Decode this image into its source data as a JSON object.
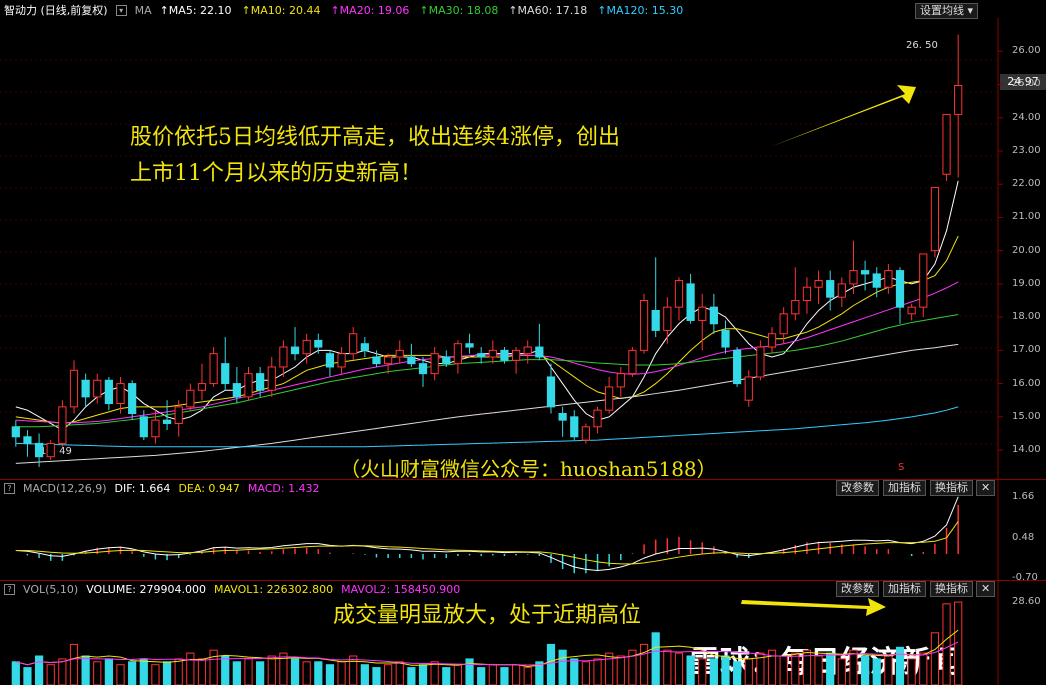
{
  "header": {
    "title": "智动力 (日线,前复权)",
    "ma_prefix": "MA",
    "ma": [
      {
        "label": "MA5: 22.10",
        "color": "#ffffff"
      },
      {
        "label": "MA10: 20.44",
        "color": "#f2e40a"
      },
      {
        "label": "MA20: 19.06",
        "color": "#ff33ff"
      },
      {
        "label": "MA30: 18.08",
        "color": "#33cc33"
      },
      {
        "label": "MA60: 17.18",
        "color": "#dddddd"
      },
      {
        "label": "MA120: 15.30",
        "color": "#33ccff"
      }
    ],
    "settings_button": "设置均线"
  },
  "price_panel": {
    "y_ticks": [
      "26.00",
      "25.00",
      "24.00",
      "23.00",
      "22.00",
      "21.00",
      "20.00",
      "19.00",
      "18.00",
      "17.00",
      "16.00",
      "15.00",
      "14.00"
    ],
    "current_price": "24.97",
    "high_label": "26. 50",
    "low_label": "13. 49",
    "marker": "S",
    "annotation_line1": "股价依托5日均线低开高走，收出连续4涨停，创出",
    "annotation_line2": "上市11个月以来的历史新高！",
    "watermark": "（火山财富微信公众号：huoshan5188）"
  },
  "macd_panel": {
    "title": "MACD(12,26,9)",
    "dif": "DIF: 1.664",
    "dea": "DEA: 0.947",
    "macd": "MACD: 1.432",
    "buttons": [
      "改参数",
      "加指标",
      "换指标"
    ],
    "y_ticks": [
      "1.66",
      "0.48",
      "-0.70"
    ]
  },
  "vol_panel": {
    "title": "VOL(5,10)",
    "volume": "VOLUME: 279904.000",
    "mavol1": "MAVOL1: 226302.800",
    "mavol2": "MAVOL2: 158450.900",
    "buttons": [
      "改参数",
      "加指标",
      "换指标"
    ],
    "y_ticks": [
      "28.60"
    ],
    "annotation": "成交量明显放大，处于近期高位",
    "logo": "雪球：每日经济新闻"
  },
  "colors": {
    "up": "#ff3333",
    "down": "#33d9e6",
    "annotation": "#f2e40a"
  },
  "chart_data": {
    "type": "candlestick",
    "ylim": [
      13.4,
      26.7
    ],
    "ohlc": [
      [
        14.7,
        14.9,
        14.1,
        14.4
      ],
      [
        14.4,
        14.6,
        13.8,
        14.2
      ],
      [
        14.2,
        14.5,
        13.49,
        13.8
      ],
      [
        13.8,
        14.3,
        13.7,
        14.2
      ],
      [
        14.2,
        15.5,
        14.1,
        15.3
      ],
      [
        15.3,
        16.7,
        15.1,
        16.4
      ],
      [
        16.1,
        16.3,
        15.3,
        15.6
      ],
      [
        15.6,
        16.3,
        15.4,
        16.1
      ],
      [
        16.1,
        16.2,
        15.2,
        15.4
      ],
      [
        15.4,
        16.2,
        15.1,
        16.0
      ],
      [
        16.0,
        16.1,
        14.9,
        15.1
      ],
      [
        15.0,
        15.2,
        14.3,
        14.4
      ],
      [
        14.4,
        15.2,
        14.2,
        14.9
      ],
      [
        14.9,
        15.5,
        14.6,
        14.8
      ],
      [
        14.8,
        15.5,
        14.4,
        15.3
      ],
      [
        15.3,
        16.0,
        15.2,
        15.8
      ],
      [
        15.8,
        16.6,
        15.5,
        16.0
      ],
      [
        16.0,
        17.1,
        15.9,
        16.9
      ],
      [
        16.6,
        17.4,
        15.8,
        16.0
      ],
      [
        16.0,
        16.5,
        15.4,
        15.6
      ],
      [
        15.6,
        16.5,
        15.5,
        16.3
      ],
      [
        16.3,
        16.5,
        15.6,
        15.8
      ],
      [
        15.8,
        16.8,
        15.6,
        16.5
      ],
      [
        16.5,
        17.3,
        16.2,
        17.1
      ],
      [
        17.1,
        17.7,
        16.7,
        16.9
      ],
      [
        16.9,
        17.5,
        16.6,
        17.3
      ],
      [
        17.3,
        17.5,
        16.9,
        17.1
      ],
      [
        16.9,
        17.0,
        16.2,
        16.5
      ],
      [
        16.5,
        17.1,
        16.3,
        16.9
      ],
      [
        16.9,
        17.7,
        16.7,
        17.5
      ],
      [
        17.2,
        17.4,
        16.8,
        17.0
      ],
      [
        16.8,
        17.0,
        16.5,
        16.6
      ],
      [
        16.6,
        16.9,
        16.3,
        16.8
      ],
      [
        16.8,
        17.3,
        16.6,
        17.0
      ],
      [
        16.8,
        17.2,
        16.5,
        16.6
      ],
      [
        16.6,
        16.8,
        15.9,
        16.3
      ],
      [
        16.3,
        17.1,
        16.1,
        16.9
      ],
      [
        16.8,
        17.0,
        16.5,
        16.6
      ],
      [
        16.6,
        17.3,
        16.3,
        17.2
      ],
      [
        17.2,
        17.5,
        16.9,
        17.1
      ],
      [
        16.9,
        17.1,
        16.6,
        16.8
      ],
      [
        16.8,
        17.3,
        16.6,
        17.0
      ],
      [
        17.0,
        17.1,
        16.6,
        16.7
      ],
      [
        16.7,
        17.1,
        16.3,
        17.0
      ],
      [
        16.9,
        17.3,
        16.6,
        17.1
      ],
      [
        17.1,
        17.8,
        16.7,
        16.8
      ],
      [
        16.2,
        16.6,
        15.1,
        15.3
      ],
      [
        15.1,
        15.3,
        14.4,
        14.9
      ],
      [
        15.0,
        15.2,
        14.3,
        14.4
      ],
      [
        14.3,
        14.8,
        14.2,
        14.7
      ],
      [
        14.7,
        15.3,
        14.5,
        15.2
      ],
      [
        15.2,
        16.2,
        15.1,
        15.9
      ],
      [
        15.9,
        16.5,
        15.6,
        16.3
      ],
      [
        16.3,
        17.1,
        16.2,
        17.0
      ],
      [
        17.0,
        18.7,
        16.9,
        18.5
      ],
      [
        18.2,
        19.8,
        17.4,
        17.6
      ],
      [
        17.6,
        18.6,
        17.2,
        18.3
      ],
      [
        18.3,
        19.2,
        17.9,
        19.1
      ],
      [
        19.0,
        19.3,
        17.8,
        17.9
      ],
      [
        17.9,
        18.7,
        17.0,
        18.3
      ],
      [
        18.3,
        18.7,
        17.5,
        17.8
      ],
      [
        17.6,
        17.9,
        16.9,
        17.1
      ],
      [
        17.0,
        17.1,
        15.9,
        16.0
      ],
      [
        15.5,
        16.4,
        15.3,
        16.2
      ],
      [
        16.2,
        17.3,
        16.1,
        17.1
      ],
      [
        17.1,
        17.7,
        16.9,
        17.5
      ],
      [
        17.5,
        18.3,
        17.2,
        18.1
      ],
      [
        18.1,
        19.5,
        17.9,
        18.5
      ],
      [
        18.5,
        19.2,
        18.1,
        18.9
      ],
      [
        18.9,
        19.4,
        18.4,
        19.1
      ],
      [
        19.1,
        19.4,
        18.2,
        18.6
      ],
      [
        18.6,
        19.2,
        18.3,
        19.0
      ],
      [
        19.0,
        20.3,
        18.7,
        19.4
      ],
      [
        19.4,
        19.7,
        18.8,
        19.3
      ],
      [
        19.3,
        19.5,
        18.6,
        18.9
      ],
      [
        18.9,
        19.6,
        18.7,
        19.4
      ],
      [
        19.4,
        19.5,
        17.8,
        18.3
      ],
      [
        18.1,
        18.4,
        17.9,
        18.3
      ],
      [
        18.3,
        19.9,
        18.0,
        19.9
      ],
      [
        20.0,
        21.9,
        19.8,
        21.9
      ],
      [
        22.3,
        24.1,
        22.1,
        24.1
      ],
      [
        24.1,
        26.5,
        22.2,
        24.97
      ]
    ],
    "ma": {
      "MA5": [
        15.3,
        15.2,
        15.0,
        14.8,
        14.6,
        14.9,
        15.3,
        15.6,
        15.8,
        15.9,
        15.7,
        15.4,
        15.2,
        15.0,
        14.9,
        15.0,
        15.2,
        15.6,
        15.8,
        15.8,
        16.0,
        16.1,
        16.1,
        16.3,
        16.5,
        16.8,
        17.0,
        17.0,
        16.9,
        16.9,
        17.0,
        16.9,
        16.8,
        16.8,
        16.8,
        16.7,
        16.6,
        16.6,
        16.7,
        16.8,
        16.9,
        16.9,
        16.9,
        16.9,
        16.9,
        17.0,
        16.5,
        16.0,
        15.5,
        15.1,
        14.9,
        15.0,
        15.3,
        15.6,
        16.2,
        16.9,
        17.4,
        17.8,
        18.1,
        18.3,
        18.2,
        18.0,
        17.6,
        17.2,
        16.9,
        16.8,
        16.9,
        17.3,
        17.8,
        18.2,
        18.5,
        18.7,
        18.9,
        19.0,
        19.1,
        19.2,
        19.1,
        19.0,
        19.1,
        19.6,
        20.6,
        22.1
      ],
      "MA10": [
        15.0,
        14.95,
        14.9,
        14.85,
        14.8,
        14.85,
        14.95,
        15.05,
        15.15,
        15.25,
        15.3,
        15.3,
        15.3,
        15.3,
        15.35,
        15.4,
        15.45,
        15.5,
        15.55,
        15.6,
        15.7,
        15.8,
        15.9,
        16.0,
        16.2,
        16.4,
        16.5,
        16.6,
        16.65,
        16.7,
        16.75,
        16.8,
        16.85,
        16.85,
        16.85,
        16.85,
        16.85,
        16.8,
        16.8,
        16.8,
        16.8,
        16.8,
        16.8,
        16.85,
        16.85,
        16.85,
        16.7,
        16.45,
        16.2,
        15.95,
        15.75,
        15.65,
        15.55,
        15.6,
        15.75,
        16.0,
        16.3,
        16.65,
        17.0,
        17.3,
        17.55,
        17.65,
        17.65,
        17.55,
        17.45,
        17.35,
        17.35,
        17.45,
        17.55,
        17.7,
        17.9,
        18.1,
        18.35,
        18.55,
        18.75,
        18.9,
        19.0,
        19.05,
        19.1,
        19.25,
        19.7,
        20.44
      ],
      "MA20": [
        14.9,
        14.88,
        14.86,
        14.84,
        14.82,
        14.82,
        14.84,
        14.86,
        14.9,
        14.95,
        15.0,
        15.05,
        15.1,
        15.15,
        15.2,
        15.25,
        15.3,
        15.38,
        15.46,
        15.55,
        15.63,
        15.72,
        15.8,
        15.88,
        15.96,
        16.04,
        16.12,
        16.2,
        16.28,
        16.36,
        16.44,
        16.5,
        16.56,
        16.62,
        16.68,
        16.72,
        16.76,
        16.8,
        16.82,
        16.84,
        16.86,
        16.86,
        16.86,
        16.86,
        16.85,
        16.84,
        16.8,
        16.72,
        16.62,
        16.52,
        16.42,
        16.35,
        16.3,
        16.28,
        16.3,
        16.36,
        16.44,
        16.55,
        16.66,
        16.78,
        16.88,
        16.96,
        17.02,
        17.06,
        17.1,
        17.14,
        17.2,
        17.28,
        17.38,
        17.5,
        17.62,
        17.74,
        17.86,
        17.98,
        18.1,
        18.22,
        18.34,
        18.46,
        18.58,
        18.72,
        18.88,
        19.06
      ],
      "MA30": [
        14.7,
        14.7,
        14.7,
        14.72,
        14.74,
        14.76,
        14.78,
        14.8,
        14.84,
        14.88,
        14.92,
        14.96,
        15.0,
        15.06,
        15.12,
        15.18,
        15.24,
        15.3,
        15.36,
        15.42,
        15.5,
        15.58,
        15.66,
        15.74,
        15.82,
        15.9,
        15.98,
        16.06,
        16.12,
        16.18,
        16.24,
        16.3,
        16.36,
        16.4,
        16.44,
        16.48,
        16.52,
        16.56,
        16.6,
        16.62,
        16.64,
        16.66,
        16.68,
        16.7,
        16.72,
        16.72,
        16.72,
        16.7,
        16.68,
        16.65,
        16.62,
        16.6,
        16.58,
        16.56,
        16.56,
        16.56,
        16.58,
        16.6,
        16.64,
        16.68,
        16.72,
        16.76,
        16.8,
        16.84,
        16.88,
        16.92,
        16.96,
        17.0,
        17.06,
        17.12,
        17.2,
        17.28,
        17.38,
        17.48,
        17.58,
        17.68,
        17.76,
        17.84,
        17.9,
        17.96,
        18.02,
        18.08
      ],
      "MA60": [
        13.6,
        13.62,
        13.64,
        13.66,
        13.68,
        13.7,
        13.72,
        13.74,
        13.76,
        13.78,
        13.8,
        13.82,
        13.84,
        13.87,
        13.9,
        13.93,
        13.96,
        14.0,
        14.04,
        14.08,
        14.12,
        14.16,
        14.2,
        14.25,
        14.3,
        14.35,
        14.4,
        14.45,
        14.5,
        14.55,
        14.6,
        14.65,
        14.7,
        14.75,
        14.8,
        14.85,
        14.9,
        14.95,
        15.0,
        15.04,
        15.08,
        15.12,
        15.16,
        15.2,
        15.24,
        15.28,
        15.32,
        15.36,
        15.4,
        15.44,
        15.48,
        15.52,
        15.56,
        15.6,
        15.65,
        15.7,
        15.75,
        15.8,
        15.86,
        15.92,
        15.98,
        16.04,
        16.1,
        16.16,
        16.22,
        16.28,
        16.34,
        16.4,
        16.46,
        16.52,
        16.58,
        16.64,
        16.7,
        16.76,
        16.82,
        16.88,
        16.94,
        17.0,
        17.04,
        17.08,
        17.13,
        17.18
      ],
      "MA120": [
        14.2,
        14.19,
        14.18,
        14.17,
        14.16,
        14.15,
        14.14,
        14.13,
        14.12,
        14.11,
        14.1,
        14.1,
        14.1,
        14.1,
        14.1,
        14.1,
        14.1,
        14.1,
        14.1,
        14.1,
        14.1,
        14.1,
        14.1,
        14.1,
        14.1,
        14.1,
        14.1,
        14.1,
        14.1,
        14.1,
        14.1,
        14.11,
        14.12,
        14.13,
        14.14,
        14.15,
        14.16,
        14.17,
        14.18,
        14.19,
        14.2,
        14.21,
        14.22,
        14.23,
        14.24,
        14.25,
        14.26,
        14.27,
        14.28,
        14.29,
        14.3,
        14.32,
        14.34,
        14.36,
        14.38,
        14.4,
        14.42,
        14.44,
        14.46,
        14.48,
        14.5,
        14.52,
        14.54,
        14.56,
        14.58,
        14.6,
        14.62,
        14.64,
        14.67,
        14.7,
        14.73,
        14.76,
        14.79,
        14.82,
        14.86,
        14.9,
        14.95,
        15.0,
        15.06,
        15.12,
        15.2,
        15.3
      ]
    },
    "macd": {
      "ylim": [
        -0.7,
        1.66
      ],
      "dif": [
        0.1,
        0.08,
        0.02,
        -0.05,
        -0.07,
        0.0,
        0.08,
        0.14,
        0.18,
        0.2,
        0.15,
        0.06,
        0.0,
        -0.03,
        -0.02,
        0.03,
        0.09,
        0.18,
        0.2,
        0.17,
        0.18,
        0.17,
        0.19,
        0.24,
        0.27,
        0.3,
        0.3,
        0.25,
        0.23,
        0.25,
        0.23,
        0.18,
        0.15,
        0.14,
        0.12,
        0.08,
        0.08,
        0.06,
        0.08,
        0.08,
        0.06,
        0.06,
        0.04,
        0.05,
        0.05,
        0.03,
        -0.1,
        -0.25,
        -0.38,
        -0.45,
        -0.48,
        -0.45,
        -0.38,
        -0.28,
        -0.12,
        0.0,
        0.08,
        0.16,
        0.16,
        0.17,
        0.14,
        0.07,
        -0.02,
        -0.05,
        0.0,
        0.05,
        0.12,
        0.2,
        0.28,
        0.33,
        0.35,
        0.37,
        0.4,
        0.4,
        0.38,
        0.4,
        0.33,
        0.3,
        0.37,
        0.52,
        0.85,
        1.664
      ],
      "dea": [
        0.1,
        0.1,
        0.08,
        0.05,
        0.03,
        0.02,
        0.03,
        0.05,
        0.08,
        0.1,
        0.11,
        0.1,
        0.08,
        0.06,
        0.04,
        0.04,
        0.05,
        0.08,
        0.1,
        0.11,
        0.13,
        0.14,
        0.15,
        0.17,
        0.19,
        0.21,
        0.23,
        0.23,
        0.23,
        0.24,
        0.24,
        0.23,
        0.21,
        0.2,
        0.18,
        0.16,
        0.14,
        0.12,
        0.11,
        0.1,
        0.09,
        0.08,
        0.07,
        0.07,
        0.06,
        0.06,
        0.03,
        -0.03,
        -0.1,
        -0.17,
        -0.23,
        -0.27,
        -0.29,
        -0.29,
        -0.26,
        -0.21,
        -0.15,
        -0.09,
        -0.04,
        0.0,
        0.03,
        0.04,
        0.03,
        0.01,
        0.01,
        0.02,
        0.04,
        0.07,
        0.11,
        0.15,
        0.19,
        0.23,
        0.26,
        0.29,
        0.31,
        0.33,
        0.33,
        0.33,
        0.34,
        0.37,
        0.47,
        0.947
      ]
    },
    "volume": {
      "ylim": [
        0,
        30
      ],
      "values": [
        8,
        6,
        10,
        7,
        9,
        14,
        10,
        8,
        9,
        7,
        8,
        9,
        7,
        8,
        9,
        11,
        9,
        12,
        10,
        8,
        9,
        8,
        10,
        11,
        9,
        8,
        8,
        7,
        8,
        10,
        7,
        6,
        7,
        8,
        6,
        7,
        8,
        6,
        7,
        9,
        6,
        7,
        6,
        7,
        6,
        8,
        14,
        12,
        9,
        8,
        9,
        11,
        10,
        12,
        14,
        18,
        12,
        11,
        10,
        9,
        9,
        10,
        8,
        9,
        11,
        12,
        10,
        11,
        12,
        10,
        11,
        9,
        12,
        10,
        9,
        10,
        13,
        9,
        11,
        18,
        28,
        28.6
      ]
    }
  }
}
